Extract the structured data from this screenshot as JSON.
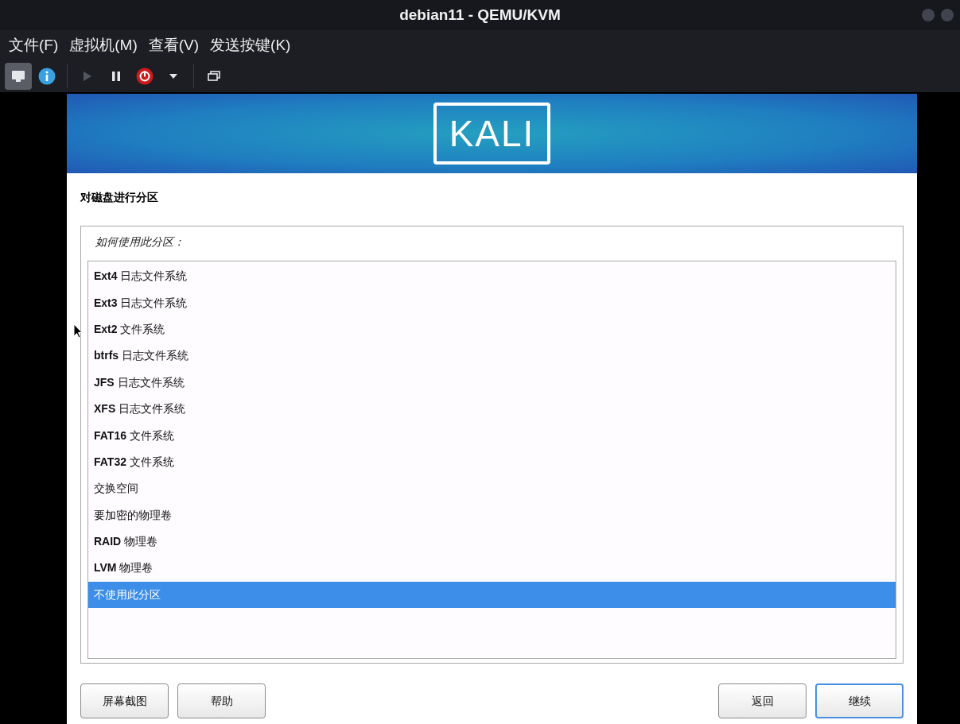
{
  "window": {
    "title": "debian11 - QEMU/KVM"
  },
  "menu": [
    "文件(F)",
    "虚拟机(M)",
    "查看(V)",
    "发送按键(K)"
  ],
  "toolbar": [
    {
      "kind": "console",
      "selected": true,
      "disabled": false
    },
    {
      "kind": "details",
      "selected": false,
      "disabled": false
    },
    {
      "kind": "run",
      "selected": false,
      "disabled": true
    },
    {
      "kind": "pause",
      "selected": false,
      "disabled": false
    },
    {
      "kind": "shutdown",
      "selected": false,
      "disabled": false
    },
    {
      "kind": "dropdown",
      "selected": false,
      "disabled": false
    },
    {
      "kind": "fullscreen",
      "selected": false,
      "disabled": false
    }
  ],
  "installer": {
    "logo": "KALI",
    "heading": "对磁盘进行分区",
    "question": "如何使用此分区：",
    "options": [
      {
        "label": "**Ext4** 日志文件系统",
        "selected": false
      },
      {
        "label": "**Ext3** 日志文件系统",
        "selected": false
      },
      {
        "label": "**Ext2** 文件系统",
        "selected": false
      },
      {
        "label": "**btrfs** 日志文件系统",
        "selected": false
      },
      {
        "label": "**JFS** 日志文件系统",
        "selected": false
      },
      {
        "label": "**XFS** 日志文件系统",
        "selected": false
      },
      {
        "label": "**FAT16** 文件系统",
        "selected": false
      },
      {
        "label": "**FAT32** 文件系统",
        "selected": false
      },
      {
        "label": "交换空间",
        "selected": false
      },
      {
        "label": "要加密的物理卷",
        "selected": false
      },
      {
        "label": "**RAID** 物理卷",
        "selected": false
      },
      {
        "label": "**LVM** 物理卷",
        "selected": false
      },
      {
        "label": "不使用此分区",
        "selected": true
      }
    ],
    "buttons_left": [
      "屏幕截图",
      "帮助"
    ],
    "buttons_right": [
      {
        "label": "返回",
        "focused": false
      },
      {
        "label": "继续",
        "focused": true
      }
    ]
  }
}
